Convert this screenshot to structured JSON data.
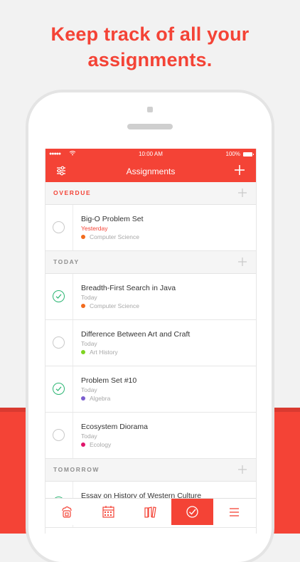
{
  "headline": {
    "line1": "Keep track of all your",
    "line2": "assignments."
  },
  "status_bar": {
    "signal": "●●●●●",
    "time": "10:00 AM",
    "battery": "100%"
  },
  "app_bar": {
    "title": "Assignments",
    "left_icon": "filter-sliders-icon",
    "right_icon": "plus-icon"
  },
  "sections": {
    "overdue": "OVERDUE",
    "today": "TODAY",
    "tomorrow": "TOMORROW"
  },
  "tasks": [
    {
      "title": "Big-O Problem Set",
      "due": "Yesterday",
      "course": "Computer Science",
      "course_color": "#f26b1d",
      "done": false
    },
    {
      "title": "Breadth-First Search in Java",
      "due": "Today",
      "course": "Computer Science",
      "course_color": "#f26b1d",
      "done": true
    },
    {
      "title": "Difference Between Art and Craft",
      "due": "Today",
      "course": "Art History",
      "course_color": "#7ed321",
      "done": false
    },
    {
      "title": "Problem Set #10",
      "due": "Today",
      "course": "Algebra",
      "course_color": "#7b5ecf",
      "done": true
    },
    {
      "title": "Ecosystem Diorama",
      "due": "Today",
      "course": "Ecology",
      "course_color": "#e0156b",
      "done": false
    },
    {
      "title": "Essay on History of Western Culture",
      "done": true
    }
  ],
  "tabs": [
    {
      "icon": "cloud-backpack-icon"
    },
    {
      "icon": "calendar-icon"
    },
    {
      "icon": "books-icon"
    },
    {
      "icon": "checkmark-circle-icon",
      "active": true
    },
    {
      "icon": "menu-icon"
    }
  ],
  "colors": {
    "accent": "#f44336",
    "done": "#2bb673",
    "background": "#f2f2f2"
  }
}
